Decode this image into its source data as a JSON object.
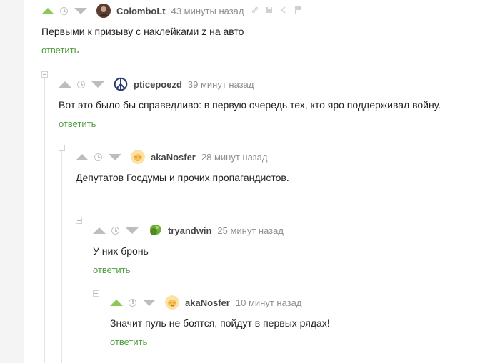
{
  "comments": [
    {
      "username": "ColomboLt",
      "time": "43 минуты назад",
      "text": "Первыми к призыву с наклейками z на авто",
      "reply": "ответить",
      "upvoted": true,
      "avatar": "photo-avatar"
    },
    {
      "username": "pticepoezd",
      "time": "39 минут назад",
      "text": "Вот это было бы справедливо: в первую очередь тех, кто яро поддерживал войну.",
      "reply": "ответить",
      "upvoted": false,
      "avatar": "peace-symbol-icon"
    },
    {
      "username": "akaNosfer",
      "time": "28 минут назад",
      "text": "Депутатов Госдумы и прочих пропагандистов.",
      "reply": "ответить",
      "upvoted": false,
      "avatar": "emoji-face-icon"
    },
    {
      "username": "tryandwin",
      "time": "25 минут назад",
      "text": "У них бронь",
      "reply": "ответить",
      "upvoted": false,
      "avatar": "green-blob-icon"
    },
    {
      "username": "akaNosfer",
      "time": "10 минут назад",
      "text": "Значит пуль не боятся, пойдут в первых рядах!",
      "reply": "ответить",
      "upvoted": true,
      "avatar": "emoji-face-icon"
    }
  ],
  "colors": {
    "upvote_active": "#8ac858",
    "reply_link": "#4d9c3d",
    "icon_gray": "#bdbdbd"
  },
  "action_icons": [
    "link-icon",
    "save-icon",
    "share-icon",
    "report-flag-icon"
  ]
}
